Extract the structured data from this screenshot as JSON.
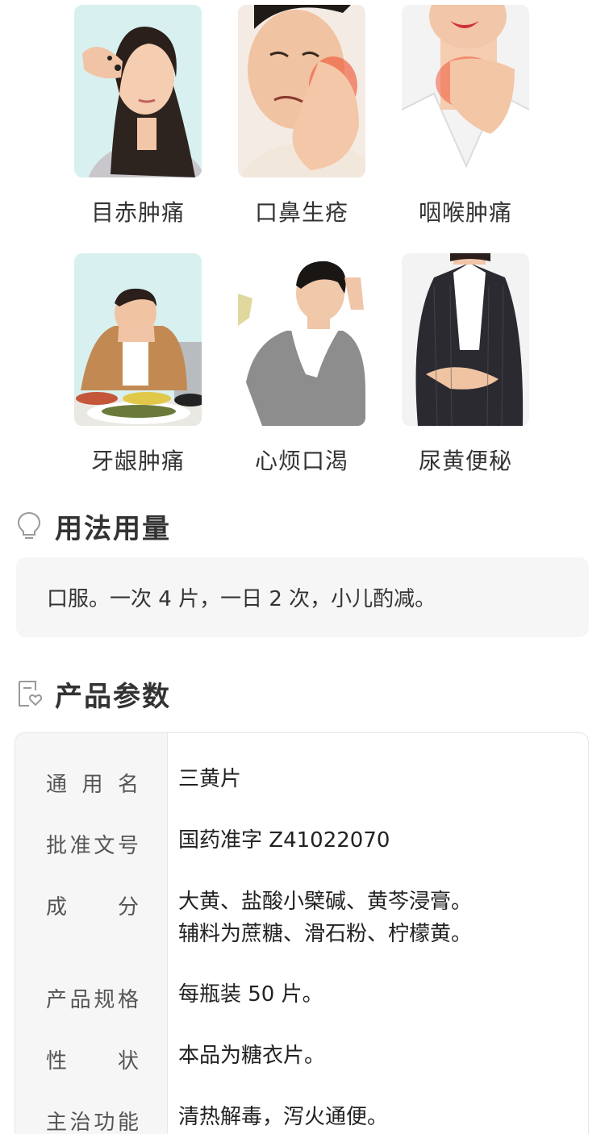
{
  "symptoms": [
    {
      "label": "目赤肿痛",
      "photo": "woman-rubbing-eye"
    },
    {
      "label": "口鼻生疮",
      "photo": "man-holding-cheek"
    },
    {
      "label": "咽喉肿痛",
      "photo": "woman-sore-throat"
    },
    {
      "label": "牙龈肿痛",
      "photo": "man-covering-face-at-dinner"
    },
    {
      "label": "心烦口渴",
      "photo": "man-with-towel"
    },
    {
      "label": "尿黄便秘",
      "photo": "woman-holding-stomach"
    }
  ],
  "usage": {
    "title": "用法用量",
    "icon": "lightbulb-icon",
    "text": "口服。一次 4 片，一日 2 次，小儿酌减。"
  },
  "params": {
    "title": "产品参数",
    "icon": "document-heart-icon",
    "rows": [
      {
        "key": "通用名",
        "value": "三黄片"
      },
      {
        "key": "批准文号",
        "value": "国药准字 Z41022070"
      },
      {
        "key": "成分",
        "value": "大黄、盐酸小檗碱、黄芩浸膏。",
        "value2": "辅料为蔗糖、滑石粉、柠檬黄。"
      },
      {
        "key": "产品规格",
        "value": "每瓶装 50 片。"
      },
      {
        "key": "性状",
        "value": "本品为糖衣片。"
      },
      {
        "key": "主治功能",
        "value": "清热解毒，泻火通便。"
      }
    ]
  },
  "colors": {
    "panel_bg": "#f6f6f6",
    "border": "#e6e6e6",
    "text": "#333333",
    "icon": "#999999"
  }
}
